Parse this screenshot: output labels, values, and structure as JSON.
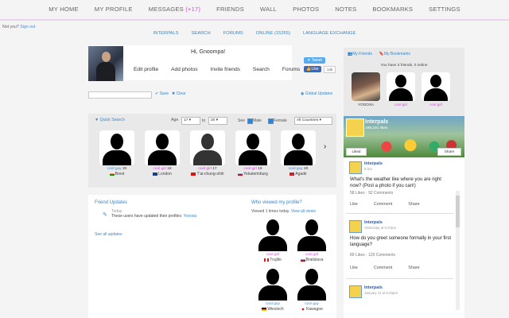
{
  "topnav": {
    "items": [
      "MY HOME",
      "MY PROFILE",
      "MESSAGES",
      "FRIENDS",
      "WALL",
      "PHOTOS",
      "NOTES",
      "BOOKMARKS",
      "SETTINGS"
    ],
    "messages_count": "(+17)"
  },
  "signout": {
    "prefix": "Not you?",
    "link": "Sign out"
  },
  "subnav": {
    "items": [
      "INTERPALS",
      "SEARCH",
      "FORUMS",
      "ONLINE (15265)",
      "LANGUAGE EXCHANGE"
    ]
  },
  "greeting": {
    "hi": "Hi, Gnoompa!",
    "buttons": [
      "Edit profile",
      "Add photos",
      "Invite friends",
      "Search",
      "Forums"
    ]
  },
  "social": {
    "tweet": "Tweet",
    "like": "Like",
    "like_count": "14k"
  },
  "search_row": {
    "save": "Save",
    "clear": "Clear",
    "global_updates": "Global Updates"
  },
  "quick_search": {
    "title": "Quick Search",
    "age_label": "Age",
    "age_from": "17",
    "to_label": "to",
    "age_to": "20",
    "see_label": "See",
    "male_label": "Male",
    "female_label": "Female",
    "country": "All Countries",
    "people": [
      {
        "name": "cool guy",
        "age": "20",
        "location": "Brest",
        "female": false,
        "gray": false
      },
      {
        "name": "cool girl",
        "age": "18",
        "location": "London",
        "female": true,
        "gray": false
      },
      {
        "name": "cool girl",
        "age": "17",
        "location": "T'ai-chung-shih",
        "female": true,
        "gray": true
      },
      {
        "name": "cool girl",
        "age": "19",
        "location": "Yekaterinburg",
        "female": true,
        "gray": false
      },
      {
        "name": "cool guy",
        "age": "20",
        "location": "Agadir",
        "female": false,
        "gray": false
      }
    ]
  },
  "friend_updates": {
    "title": "Friend Updates",
    "today": "Today",
    "message": "These users have updated their profiles:",
    "user": "Yoooxa",
    "see_all": "See all updates"
  },
  "who_viewed": {
    "title": "Who viewed my profile?",
    "sub": "Viewed 1 times today.",
    "view_all": "View all views",
    "people": [
      {
        "name": "cool girl",
        "location": "Trujillo"
      },
      {
        "name": "cool girl",
        "location": "Bratislava"
      },
      {
        "name": "cool guy",
        "location": "Wiesloch"
      },
      {
        "name": "cool guy",
        "location": "Kawagoe"
      }
    ]
  },
  "right_panel": {
    "tab_friends": "My Friends",
    "tab_bookmarks": "My Bookmarks",
    "info": "You have 3 friends, 0 online",
    "friends": [
      "YOOOXA",
      "cool girl",
      "cool girl"
    ]
  },
  "facebook": {
    "page_name": "Interpals",
    "likes": "199,331 likes",
    "liked_btn": "Liked",
    "share_btn": "Share",
    "posts": [
      {
        "author": "Interpals",
        "time": "9 hrs",
        "text": "What's the weather like where you are right now? (Post a photo if you can!)",
        "stats": "58 Likes · 92 Comments"
      },
      {
        "author": "Interpals",
        "time": "Yesterday at 5:37pm",
        "text": "How do you greet someone formally in your first language?",
        "stats": "89 Likes · 120 Comments"
      },
      {
        "author": "Interpals",
        "time": "January 11 at 6:46pm",
        "text": "",
        "stats": ""
      }
    ],
    "actions": [
      "Like",
      "Comment",
      "Share"
    ]
  }
}
